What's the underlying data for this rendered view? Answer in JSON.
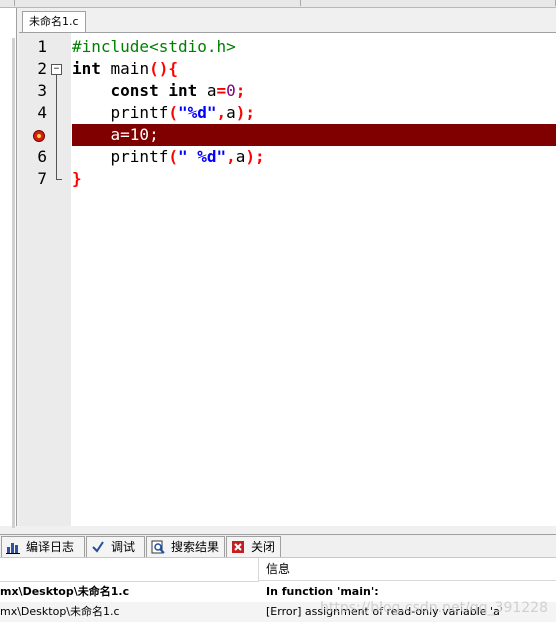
{
  "editor": {
    "tab_label": "未命名1.c",
    "line_numbers": [
      "1",
      "2",
      "3",
      "4",
      "5",
      "6",
      "7"
    ],
    "highlight_color": "#800000",
    "breakpoint_line": "5"
  },
  "bottom_tabs": [
    {
      "label": "编译日志",
      "icon": "chart-icon"
    },
    {
      "label": "调试",
      "icon": "check-icon"
    },
    {
      "label": "搜索结果",
      "icon": "search-icon"
    },
    {
      "label": "关闭",
      "icon": "close-icon"
    }
  ],
  "log": {
    "header_message": "信息",
    "rows": [
      {
        "file": "mx\\Desktop\\未命名1.c",
        "message": "In function 'main':"
      },
      {
        "file": "mx\\Desktop\\未命名1.c",
        "message": "[Error] assignment of read-only variable 'a'"
      }
    ]
  },
  "watermark": "https://blog.csdn.net/qq_391228"
}
